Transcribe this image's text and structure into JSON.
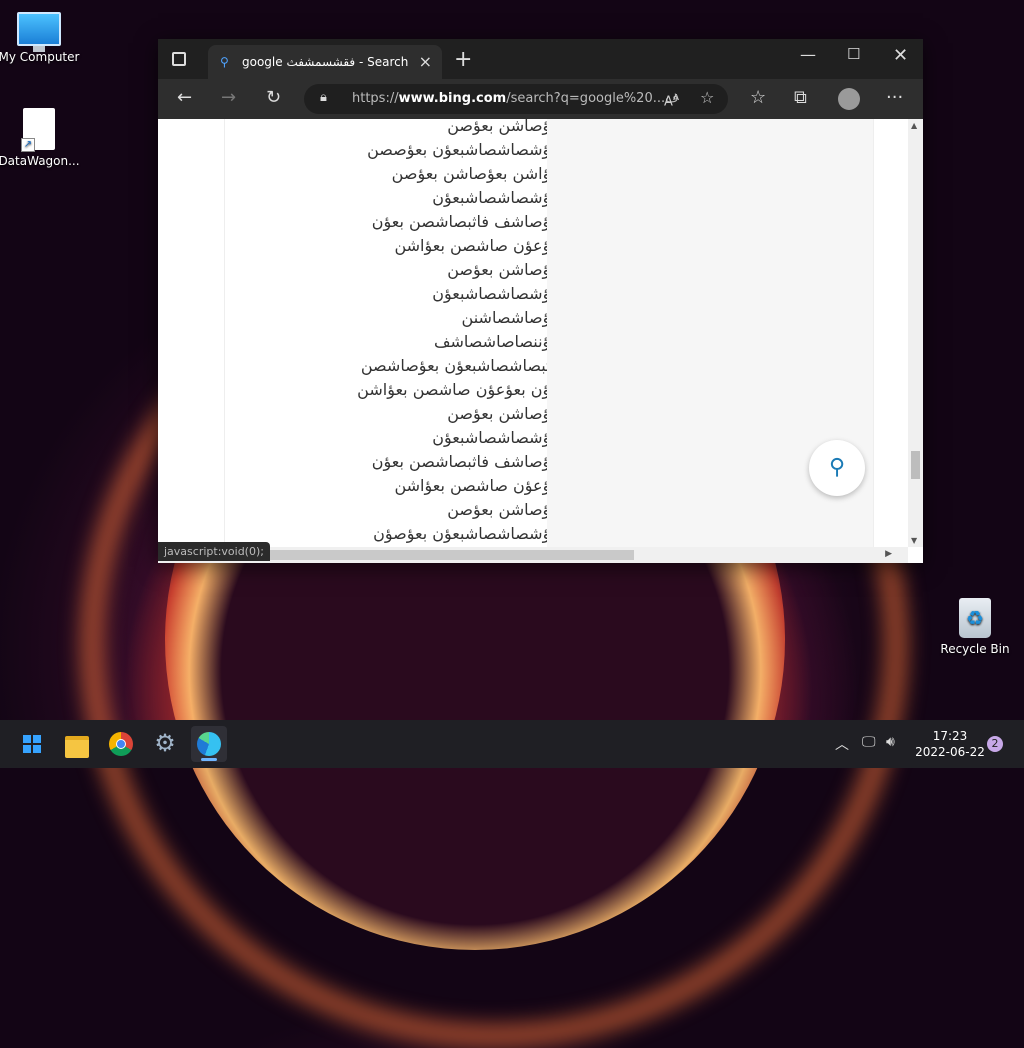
{
  "desktop": {
    "icons": [
      {
        "label": "My Computer"
      },
      {
        "label": "DataWagon..."
      },
      {
        "label": "Recycle Bin"
      }
    ]
  },
  "browser": {
    "tab_title": "google فقشسمشفث - Search",
    "url_prefix": "https://",
    "url_host": "www.bing.com",
    "url_rest": "/search?q=google%20...ف",
    "status_text": "javascript:void(0);",
    "result_lines": [
      "بعؤصاشن بعؤصن",
      "بعؤشصاشصاشبعؤن بعؤصصن",
      "بعؤاشن بعؤصاشن بعؤصن",
      "بعؤشصاشصاشبعؤن",
      "بعؤصاشف فاثبصاشصن بعؤن",
      "بعؤعؤن صاشصن بعؤاشن",
      "بعؤصاشن بعؤصن",
      "بعؤشصاشصاشبعؤن",
      "بعؤصاشصاشنن",
      "بعؤننصاصاشصاشف",
      "فاثبصاشصاشبعؤن بعؤصاشصن",
      "بعؤن بعؤعؤن صاشصن بعؤاشن",
      "بعؤصاشن بعؤصن",
      "بعؤشصاشصاشبعؤن",
      "بعؤصاشف فاثبصاشصن بعؤن",
      "بعؤعؤن صاشصن بعؤاشن",
      "بعؤصاشن بعؤصن",
      "بعؤشصاشصاشبعؤن بعؤصؤن"
    ]
  },
  "taskbar": {
    "time": "17:23",
    "date": "2022-06-22",
    "notification_count": "2"
  }
}
